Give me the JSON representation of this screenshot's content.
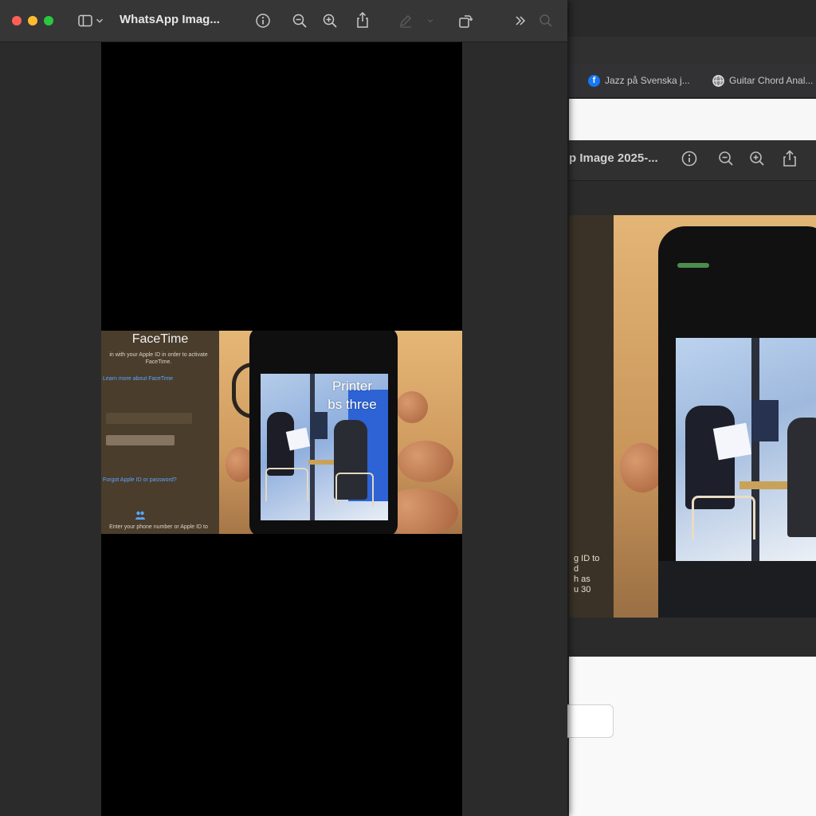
{
  "front_window": {
    "title": "WhatsApp Imag...",
    "toolbar": {
      "sidebar_icon": "sidebar-icon",
      "chevron_icon": "chevron-down-icon",
      "info_icon": "info-icon",
      "zoom_out_icon": "zoom-out-icon",
      "zoom_in_icon": "zoom-in-icon",
      "share_icon": "share-icon",
      "markup_icon": "markup-pen-icon",
      "rotate_icon": "rotate-icon",
      "more_icon": "chevron-double-right-icon",
      "search_icon": "search-icon"
    },
    "image": {
      "facetime_title": "FaceTime",
      "facetime_signin": "in with your Apple ID in order to activate FaceTime.",
      "facetime_learn_more": "Learn more about FaceTime",
      "facetime_forgot": "Forgot Apple ID or password?",
      "facetime_phone_note": "Enter your phone number or Apple ID to",
      "caption_line1": "Printer",
      "caption_line2": "bs three"
    }
  },
  "background_browser": {
    "bookmarks": [
      {
        "label": "Jazz på Svenska j...",
        "icon": "facebook-icon",
        "color": "#1877f2"
      },
      {
        "label": "Guitar Chord Anal...",
        "icon": "globe-icon",
        "color": "#9a9a9a"
      }
    ]
  },
  "background_preview": {
    "title": "p Image 2025-...",
    "side_text": [
      "g ID to",
      "d",
      "h as",
      "u 30"
    ]
  },
  "colors": {
    "close": "#fe5f57",
    "minimize": "#febc2e",
    "maximize": "#28c840",
    "link": "#5aa6ff"
  }
}
